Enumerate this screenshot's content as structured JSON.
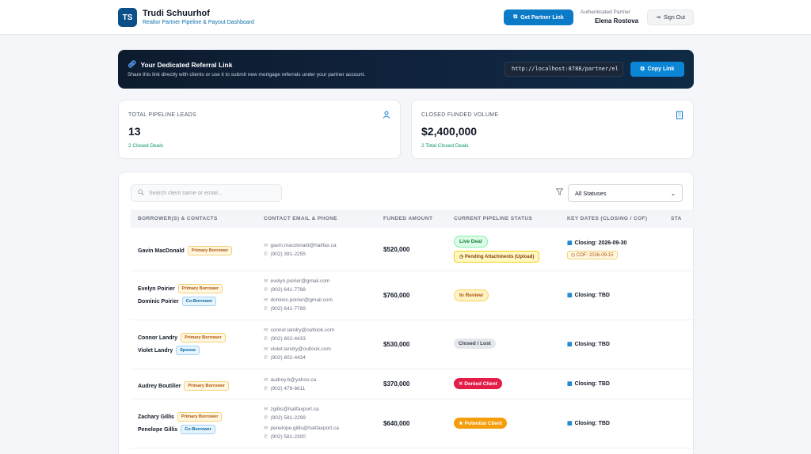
{
  "header": {
    "avatar": "TS",
    "title": "Trudi Schuurhof",
    "subtitle": "Realtor Partner Pipeline & Payout Dashboard",
    "partner_link_label": "Get Partner Link",
    "auth_label": "Authenticated Partner",
    "auth_name": "Elena Rostova",
    "signout_label": "Sign Out"
  },
  "referral": {
    "title": "Your Dedicated Referral Link",
    "subtitle": "Share this link directly with clients or use it to submit new mortgage referrals under your partner account.",
    "url": "http://localhost:8788/partner/el",
    "copy_label": "Copy Link"
  },
  "stats": [
    {
      "label": "TOTAL PIPELINE LEADS",
      "value": "13",
      "note": "2 Closed Deals",
      "icon": "user-icon"
    },
    {
      "label": "CLOSED FUNDED VOLUME",
      "value": "$2,400,000",
      "note": "2 Total Closed Deals",
      "icon": "building-icon"
    }
  ],
  "filters": {
    "search_placeholder": "Search client name or email...",
    "status_selected": "All Statuses"
  },
  "table": {
    "headers": [
      "BORROWER(S) & CONTACTS",
      "CONTACT EMAIL & PHONE",
      "FUNDED AMOUNT",
      "CURRENT PIPELINE STATUS",
      "KEY DATES (CLOSING / COF)",
      "STA"
    ],
    "rows": [
      {
        "people": [
          {
            "name": "Gavin MacDonald",
            "role": "Primary Borrower"
          }
        ],
        "contacts": [
          {
            "email": "gavin.macdonald@halifax.ca",
            "phone": "(902) 391-2255"
          }
        ],
        "amount": "$520,000",
        "status": "Live Deal",
        "substatus": "Pending Attachments (Upload)",
        "closing": "Closing: 2026-09-30",
        "cof": "COF: 2026-09-15"
      },
      {
        "people": [
          {
            "name": "Evelyn Poirier",
            "role": "Primary Borrower"
          },
          {
            "name": "Dominic Poirier",
            "role": "Co-Borrower"
          }
        ],
        "contacts": [
          {
            "email": "evelyn.poirier@gmail.com",
            "phone": "(902) 641-7788"
          },
          {
            "email": "dominic.poirier@gmail.com",
            "phone": "(902) 641-7789"
          }
        ],
        "amount": "$760,000",
        "status": "In Review",
        "closing": "Closing: TBD"
      },
      {
        "people": [
          {
            "name": "Connor Landry",
            "role": "Primary Borrower"
          },
          {
            "name": "Violet Landry",
            "role": "Spouse"
          }
        ],
        "contacts": [
          {
            "email": "connor.landry@outlook.com",
            "phone": "(902) 802-4433"
          },
          {
            "email": "violet.landry@outlook.com",
            "phone": "(902) 802-4434"
          }
        ],
        "amount": "$530,000",
        "status": "Closed / Lost",
        "closing": "Closing: TBD"
      },
      {
        "people": [
          {
            "name": "Audrey Boutilier",
            "role": "Primary Borrower"
          }
        ],
        "contacts": [
          {
            "email": "audrey.b@yahoo.ca",
            "phone": "(902) 479-6611"
          }
        ],
        "amount": "$370,000",
        "status": "Denied Client",
        "closing": "Closing: TBD"
      },
      {
        "people": [
          {
            "name": "Zachary Gillis",
            "role": "Primary Borrower"
          },
          {
            "name": "Penelope Gillis",
            "role": "Co-Borrower"
          }
        ],
        "contacts": [
          {
            "email": "zgillis@halifaxport.ca",
            "phone": "(902) 581-2299"
          },
          {
            "email": "penelope.gillis@halifaxport.ca",
            "phone": "(902) 581-2300"
          }
        ],
        "amount": "$640,000",
        "status": "Potential Client",
        "closing": "Closing: TBD"
      }
    ]
  },
  "colors": {
    "primary": "#0b7bc8",
    "brand": "#0b4f8a",
    "success": "#059669",
    "denied": "#e11d48",
    "potential": "#f59e0b"
  }
}
